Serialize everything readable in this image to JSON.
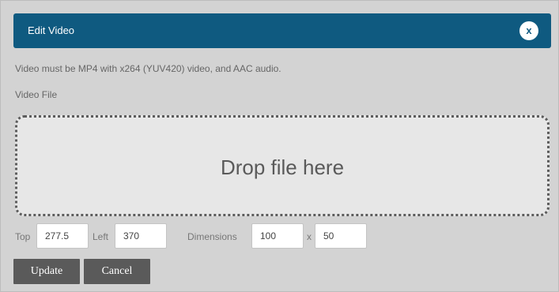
{
  "dialog": {
    "title": "Edit Video",
    "close_label": "x",
    "info_text": "Video must be MP4 with x264 (YUV420) video, and AAC audio.",
    "video_file_label": "Video File",
    "dropzone_text": "Drop file here"
  },
  "position": {
    "top_label": "Top",
    "top_value": "277.5",
    "left_label": "Left",
    "left_value": "370",
    "dimensions_label": "Dimensions",
    "width_value": "100",
    "times_label": "x",
    "height_value": "50"
  },
  "actions": {
    "update_label": "Update",
    "cancel_label": "Cancel"
  },
  "colors": {
    "titlebar": "#0f5a80",
    "dialog_bg": "#d3d3d3",
    "button_bg": "#5a5a5a"
  }
}
